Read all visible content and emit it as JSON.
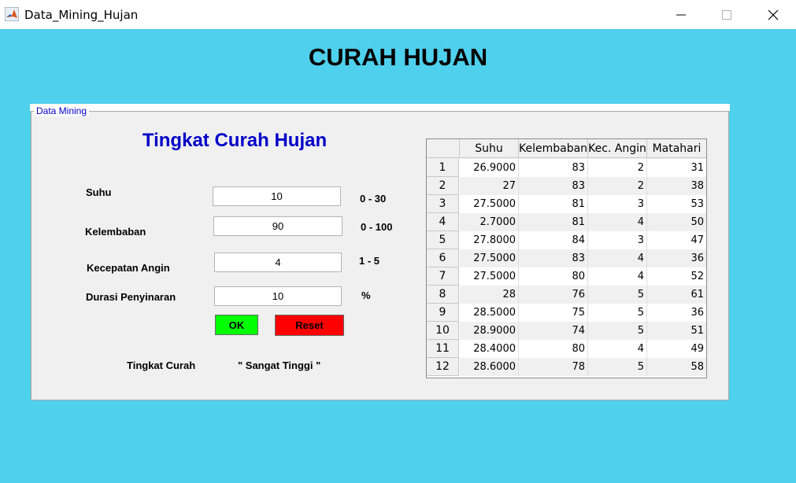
{
  "window": {
    "title": "Data_Mining_Hujan"
  },
  "header": {
    "title": "CURAH HUJAN"
  },
  "panel": {
    "label": "Data Mining",
    "subtitle": "Tingkat Curah Hujan"
  },
  "form": {
    "suhu": {
      "label": "Suhu",
      "value": "10",
      "range": "0 - 30"
    },
    "kelembaban": {
      "label": "Kelembaban",
      "value": "90",
      "range": "0 - 100"
    },
    "angin": {
      "label": "Kecepatan Angin",
      "value": "4",
      "range": "1 - 5"
    },
    "durasi": {
      "label": "Durasi Penyinaran",
      "value": "10",
      "range": "%"
    },
    "ok_label": "OK",
    "reset_label": "Reset",
    "result_label": "Tingkat Curah",
    "result_value": "\" Sangat Tinggi \""
  },
  "table": {
    "columns": [
      "Suhu",
      "Kelembaban",
      "Kec. Angin",
      "Matahari"
    ],
    "rows": [
      [
        "1",
        "26.9000",
        "83",
        "2",
        "31"
      ],
      [
        "2",
        "27",
        "83",
        "2",
        "38"
      ],
      [
        "3",
        "27.5000",
        "81",
        "3",
        "53"
      ],
      [
        "4",
        "2.7000",
        "81",
        "4",
        "50"
      ],
      [
        "5",
        "27.8000",
        "84",
        "3",
        "47"
      ],
      [
        "6",
        "27.5000",
        "83",
        "4",
        "36"
      ],
      [
        "7",
        "27.5000",
        "80",
        "4",
        "52"
      ],
      [
        "8",
        "28",
        "76",
        "5",
        "61"
      ],
      [
        "9",
        "28.5000",
        "75",
        "5",
        "36"
      ],
      [
        "10",
        "28.9000",
        "74",
        "5",
        "51"
      ],
      [
        "11",
        "28.4000",
        "80",
        "4",
        "49"
      ],
      [
        "12",
        "28.6000",
        "78",
        "5",
        "58"
      ]
    ]
  },
  "colors": {
    "background": "#4fd0ec",
    "ok_button": "#00ff00",
    "reset_button": "#ff0000",
    "accent_text": "#0000c8"
  },
  "icons": {
    "app": "matlab-icon",
    "minimize": "minimize-icon",
    "maximize": "maximize-icon",
    "close": "close-icon"
  }
}
